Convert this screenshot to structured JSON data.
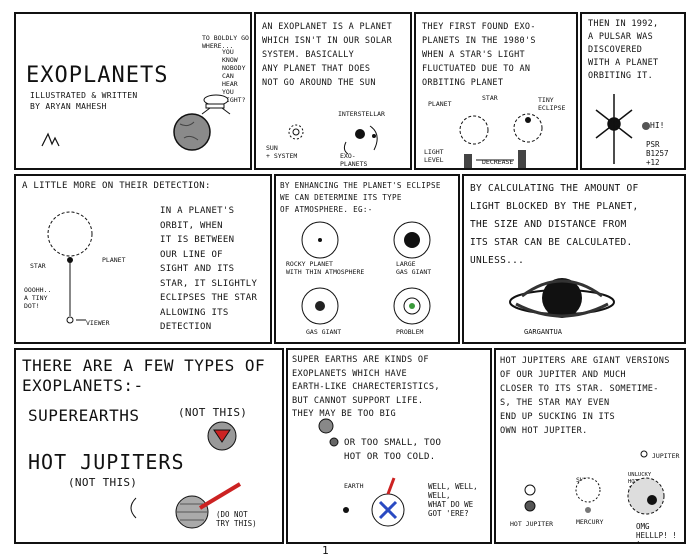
{
  "p1": {
    "title": "EXOPLANETS",
    "byline": "ILLUSTRATED & WRITTEN\nBY ARYAN MAHESH",
    "bubble1": "TO BOLDLY GO\nWHERE...",
    "bubble2": "YOU KNOW\nNOBODY\nCAN HEAR\nYOU\nRIGHT?"
  },
  "p2": {
    "text": "AN EXOPLANET IS A PLANET\nWHICH ISN'T IN OUR SOLAR\nSYSTEM. BASICALLY\nANY PLANET THAT DOES\nNOT GO AROUND THE SUN",
    "lbl_interstellar": "INTERSTELLAR",
    "lbl_sun": "SUN\n+ SYSTEM",
    "lbl_exo": "EXO-\nPLANETS"
  },
  "p3": {
    "text": "THEY FIRST FOUND EXO-\nPLANETS IN THE 1980'S\nWHEN A STAR'S LIGHT\nFLUCTUATED DUE TO AN\nORBITING PLANET",
    "lbl_planet": "PLANET",
    "lbl_star": "STAR",
    "lbl_tiny": "TINY\nECLIPSE",
    "lbl_light": "LIGHT\nLEVEL",
    "lbl_decrease": "DECREASE"
  },
  "p4": {
    "text": "THEN IN 1992,\nA PULSAR WAS\nDISCOVERED\nWITH A PLANET\nORBITING IT.",
    "lbl_hi": "HI!",
    "lbl_psr": "PSR\nB1257\n+12"
  },
  "p5": {
    "heading": "A LITTLE MORE ON THEIR DETECTION:",
    "text": "IN A PLANET'S\nORBIT, WHEN\nIT IS BETWEEN\nOUR LINE OF\nSIGHT AND ITS\nSTAR, IT SLIGHTLY\nECLIPSES THE STAR\nALLOWING ITS\nDETECTION",
    "lbl_star": "STAR",
    "lbl_planet": "PLANET",
    "lbl_dot": "OOOHH..\nA TINY\nDOT!",
    "lbl_viewer": "VIEWER"
  },
  "p6": {
    "text": "BY ENHANCING THE PLANET'S ECLIPSE\nWE CAN DETERMINE ITS TYPE\nOF ATMOSPHERE. EG:-",
    "lbl_rocky": "ROCKY PLANET\nWITH THIN ATMOSPHERE",
    "lbl_large": "LARGE\nGAS GIANT",
    "lbl_gas": "GAS GIANT",
    "lbl_problem": "PROBLEM"
  },
  "p7": {
    "text": "BY CALCULATING THE AMOUNT OF\nLIGHT BLOCKED BY THE PLANET,\nTHE SIZE AND DISTANCE FROM\nITS STAR CAN BE CALCULATED.\nUNLESS...",
    "lbl_garg": "GARGANTUA"
  },
  "p8": {
    "text1": "THERE ARE A FEW TYPES OF\nEXOPLANETS:-",
    "text2": "SUPEREARTHS",
    "text2b": "(NOT THIS)",
    "text3": "HOT JUPITERS",
    "text3b": "(NOT THIS)",
    "lbl_dont": "(DO NOT\nTRY THIS)"
  },
  "p9": {
    "text": "SUPER EARTHS ARE KINDS OF\nEXOPLANETS WHICH HAVE\nEARTH-LIKE CHARECTERISTICS,\nBUT CANNOT SUPPORT LIFE.\nTHEY MAY BE TOO BIG",
    "text2": "OR TOO SMALL, TOO\nHOT OR TOO COLD.",
    "lbl_earth": "EARTH",
    "lbl_well": "WELL, WELL,\nWELL,\nWHAT DO WE\nGOT 'ERE?"
  },
  "p10": {
    "text": "HOT JUPITERS ARE GIANT VERSIONS\nOF OUR JUPITER AND MUCH\nCLOSER TO ITS STAR. SOMETIME-\nS, THE STAR MAY EVEN\nEND UP SUCKING IN ITS\nOWN HOT JUPITER.",
    "lbl_jup": "JUPITER",
    "lbl_sun": "SUN",
    "lbl_unlucky": "UNLUCKY\nHOT\nJUPITER",
    "lbl_hot": "HOT JUPITER",
    "lbl_merc": "MERCURY",
    "lbl_omg": "OMG\nHELLLP! ! !"
  },
  "page_number": "1"
}
